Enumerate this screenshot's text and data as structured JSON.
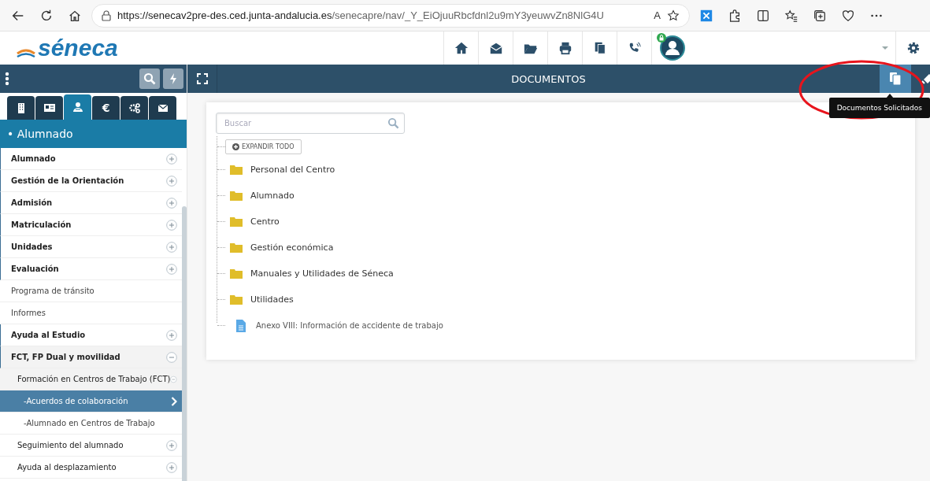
{
  "browser": {
    "url_host": "https://senecav2pre-des.ced.junta-andalucia.es",
    "url_path": "/senecapre/nav/_Y_EiOjuuRbcfdnl2u9mY3yeuwvZn8NlG4U",
    "read_aloud": "A"
  },
  "header": {
    "logo": "séneca"
  },
  "sidebar": {
    "tabs": [
      {
        "selected": false
      },
      {
        "selected": false
      },
      {
        "selected": true
      },
      {
        "label": "€",
        "selected": false
      },
      {
        "selected": false
      },
      {
        "selected": false
      }
    ],
    "section_title": "• Alumnado",
    "items": [
      {
        "label": "Alumnado",
        "expandable": true,
        "expanded": false
      },
      {
        "label": "Gestión de la Orientación",
        "expandable": true,
        "expanded": false
      },
      {
        "label": "Admisión",
        "expandable": true,
        "expanded": false
      },
      {
        "label": "Matriculación",
        "expandable": true,
        "expanded": false
      },
      {
        "label": "Unidades",
        "expandable": true,
        "expanded": false
      },
      {
        "label": "Evaluación",
        "expandable": true,
        "expanded": false
      },
      {
        "label": "Programa de tránsito",
        "expandable": false
      },
      {
        "label": "Informes",
        "expandable": false
      },
      {
        "label": "Ayuda al Estudio",
        "expandable": true,
        "expanded": false
      },
      {
        "label": "FCT, FP Dual y movilidad",
        "expandable": true,
        "expanded": true,
        "children": [
          {
            "label": "Formación en Centros de Trabajo (FCT)",
            "expandable": true,
            "expanded": true,
            "children": [
              {
                "label": "-Acuerdos de colaboración",
                "expandable": false,
                "selected": true
              },
              {
                "label": "-Alumnado en Centros de Trabajo",
                "expandable": false,
                "selected": false
              }
            ]
          },
          {
            "label": "Seguimiento del alumnado",
            "expandable": true,
            "expanded": false
          },
          {
            "label": "Ayuda al desplazamiento",
            "expandable": true,
            "expanded": false
          }
        ]
      }
    ]
  },
  "main": {
    "title": "DOCUMENTOS",
    "tooltip": "Documentos Solicitados",
    "search": {
      "placeholder": "Buscar"
    },
    "expand_all": "EXPANDIR TODO",
    "tree": [
      {
        "kind": "folder",
        "label": "Personal del Centro"
      },
      {
        "kind": "folder",
        "label": "Alumnado"
      },
      {
        "kind": "folder",
        "label": "Centro"
      },
      {
        "kind": "folder",
        "label": "Gestión económica"
      },
      {
        "kind": "folder",
        "label": "Manuales y Utilidades de Séneca"
      },
      {
        "kind": "folder",
        "label": "Utilidades"
      },
      {
        "kind": "file",
        "label": "Anexo VIII: Información de accidente de trabajo"
      }
    ]
  }
}
